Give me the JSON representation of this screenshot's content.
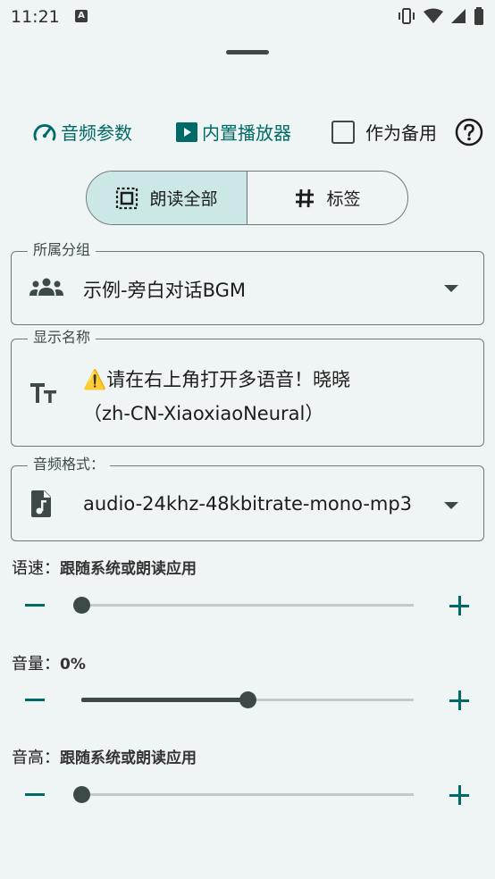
{
  "status_bar": {
    "time": "11:21",
    "notification_badge": "A"
  },
  "toolbar": {
    "audio_params_label": "音频参数",
    "builtin_player_label": "内置播放器",
    "backup_label": "作为备用",
    "backup_checked": false
  },
  "segmented": {
    "read_all_label": "朗读全部",
    "tags_label": "标签",
    "selected": "read_all"
  },
  "group_field": {
    "label": "所属分组",
    "value": "示例-旁白对话BGM"
  },
  "name_field": {
    "label": "显示名称",
    "value_line1": "⚠️请在右上角打开多语音！晓晓",
    "value_line2": "（zh-CN-XiaoxiaoNeural）"
  },
  "format_field": {
    "label": "音频格式：",
    "value": "audio-24khz-48kbitrate-mono-mp3"
  },
  "sliders": {
    "speed": {
      "label": "语速：",
      "value": "跟随系统或朗读应用",
      "level": 0
    },
    "volume": {
      "label": "音量：",
      "value": "0%",
      "level": 0.5
    },
    "pitch": {
      "label": "音高：",
      "value": "跟随系统或朗读应用",
      "level": 0
    }
  },
  "colors": {
    "accent": "#006a67",
    "background": "#eef5f4",
    "selected_segment": "#cce8e6"
  }
}
